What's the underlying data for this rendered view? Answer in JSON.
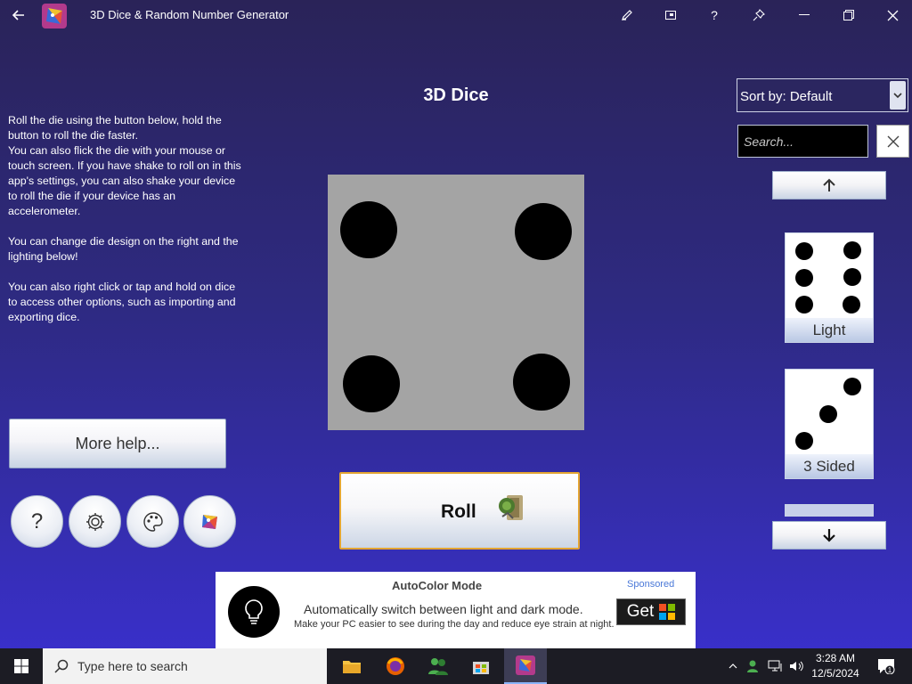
{
  "window": {
    "title": "3D Dice & Random Number Generator",
    "buttons": [
      "back-arrow-icon",
      "pen-icon",
      "compact-overlay-icon",
      "help-icon",
      "pin-icon",
      "minimize-icon",
      "restore-icon",
      "close-icon"
    ]
  },
  "main": {
    "title": "3D Dice",
    "help_paragraphs": [
      "Roll the die using the button below, hold the button to roll the die faster.\nYou can also flick the die with your mouse or touch screen. If you have shake to roll on in this app's settings, you can also shake your device to roll the die if your device has an accelerometer.",
      "You can change die design on the right and the lighting  below!",
      "You can also right click or tap and hold on dice to access other options, such as importing and exporting dice."
    ],
    "more_help_label": "More help...",
    "circle_buttons": [
      {
        "name": "help",
        "glyph": "?"
      },
      {
        "name": "settings",
        "icon": "gear-icon"
      },
      {
        "name": "palette",
        "icon": "palette-icon"
      },
      {
        "name": "app-logo",
        "icon": "dice-logo-icon"
      }
    ],
    "die_face_value": 4,
    "roll_label": "Roll"
  },
  "sidebar": {
    "sort_label": "Sort by: Default",
    "search_placeholder": "Search...",
    "dice": [
      {
        "label": "Light",
        "pips": 6
      },
      {
        "label": "3 Sided",
        "pips": 3
      }
    ]
  },
  "ad": {
    "title": "AutoColor Mode",
    "badge": "Sponsored",
    "description": "Automatically switch between light and dark mode.",
    "subtext": "Make your PC easier to see during the day and reduce eye strain at night.",
    "cta": "Get"
  },
  "taskbar": {
    "search_placeholder": "Type here to search",
    "time": "3:28 AM",
    "date": "12/5/2024",
    "notification_count": "1"
  },
  "colors": {
    "background_top": "#2a2358",
    "background_bottom": "#3a30d0",
    "die_face": "#a4a4a4",
    "roll_border": "#e3a532"
  }
}
